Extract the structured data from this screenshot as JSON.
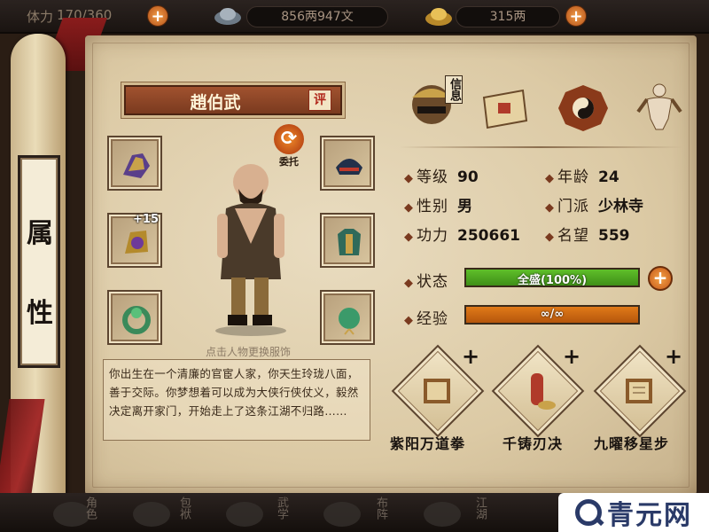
{
  "topbar": {
    "stamina_label": "体力",
    "stamina_value": "170/360",
    "money": "856两947文",
    "ingots": "315两"
  },
  "scroll": {
    "title_chars": [
      "属",
      "性"
    ]
  },
  "character": {
    "name": "趙伯武",
    "rate_label": "评",
    "delegate_label": "委托",
    "change_outfit_hint": "点击人物更换服饰",
    "bio": "你出生在一个清廉的官宦人家，你天生玲珑八面，善于交际。你梦想着可以成为大侠行侠仗义，毅然决定离开家门，开始走上了这条江湖不归路……",
    "equipment_badge": "+15"
  },
  "tabs": {
    "info_label": "信息"
  },
  "stats": {
    "level_label": "等级",
    "level": "90",
    "age_label": "年龄",
    "age": "24",
    "gender_label": "性别",
    "gender": "男",
    "sect_label": "门派",
    "sect": "少林寺",
    "power_label": "功力",
    "power": "250661",
    "fame_label": "名望",
    "fame": "559",
    "status_label": "状态",
    "status_text": "全盛(100%)",
    "status_fraction": 1.0,
    "exp_label": "经验",
    "exp_text": "∞/∞"
  },
  "skills": [
    {
      "name": "紫阳万道拳"
    },
    {
      "name": "千铸刃决"
    },
    {
      "name": "九曜移星步"
    }
  ],
  "bottom_tabs": [
    "角色",
    "包袱",
    "武学",
    "布阵",
    "江湖"
  ],
  "brand": {
    "text": "青元网"
  },
  "colors": {
    "status_bar": "#5fbf2a",
    "exp_bar": "#e07a18",
    "banner": "#8f4526",
    "parchment": "#e3d3b2"
  }
}
